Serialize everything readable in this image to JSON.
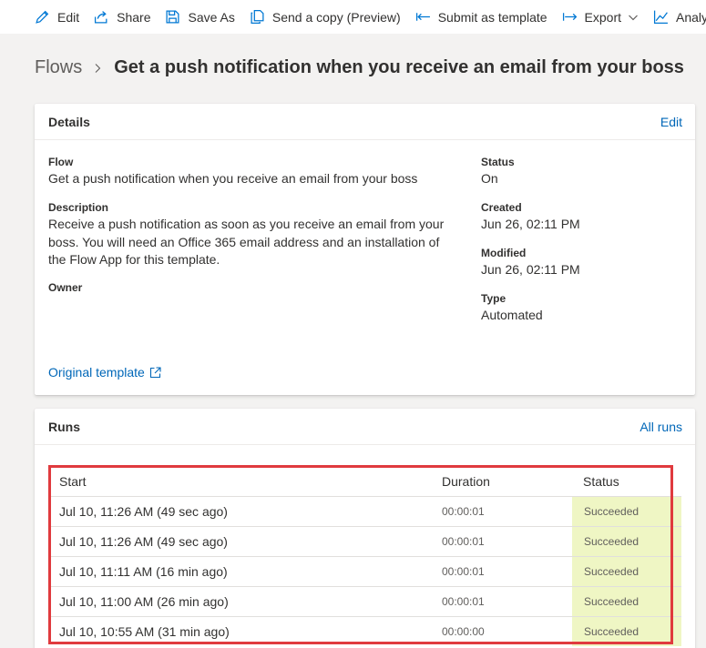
{
  "toolbar": {
    "edit": "Edit",
    "share": "Share",
    "save_as": "Save As",
    "send_copy": "Send a copy (Preview)",
    "submit_template": "Submit as template",
    "export": "Export",
    "analytics": "Analytics"
  },
  "breadcrumb": {
    "root": "Flows",
    "title": "Get a push notification when you receive an email from your boss"
  },
  "details": {
    "header": "Details",
    "edit_link": "Edit",
    "flow_label": "Flow",
    "flow_value": "Get a push notification when you receive an email from your boss",
    "description_label": "Description",
    "description_value": "Receive a push notification as soon as you receive an email from your boss. You will need an Office 365 email address and an installation of the Flow App for this template.",
    "owner_label": "Owner",
    "status_label": "Status",
    "status_value": "On",
    "created_label": "Created",
    "created_value": "Jun 26, 02:11 PM",
    "modified_label": "Modified",
    "modified_value": "Jun 26, 02:11 PM",
    "type_label": "Type",
    "type_value": "Automated",
    "original_template": "Original template"
  },
  "runs": {
    "header": "Runs",
    "all_runs_link": "All runs",
    "columns": {
      "start": "Start",
      "duration": "Duration",
      "status": "Status"
    },
    "rows": [
      {
        "start": "Jul 10, 11:26 AM (49 sec ago)",
        "duration": "00:00:01",
        "status": "Succeeded"
      },
      {
        "start": "Jul 10, 11:26 AM (49 sec ago)",
        "duration": "00:00:01",
        "status": "Succeeded"
      },
      {
        "start": "Jul 10, 11:11 AM (16 min ago)",
        "duration": "00:00:01",
        "status": "Succeeded"
      },
      {
        "start": "Jul 10, 11:00 AM (26 min ago)",
        "duration": "00:00:01",
        "status": "Succeeded"
      },
      {
        "start": "Jul 10, 10:55 AM (31 min ago)",
        "duration": "00:00:00",
        "status": "Succeeded"
      }
    ]
  },
  "colors": {
    "link": "#0067b8",
    "succeeded_bg": "#eff6c4",
    "highlight_border": "#e03a3e"
  }
}
